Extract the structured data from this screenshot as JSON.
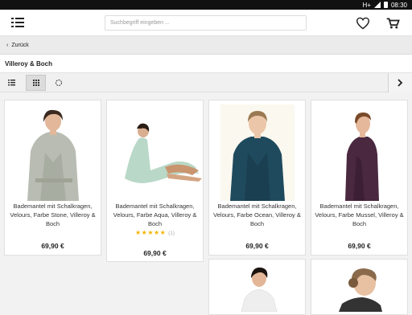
{
  "status": {
    "network": "H+",
    "time": "08:30"
  },
  "search": {
    "placeholder": "Suchbegriff eingeben ..."
  },
  "nav": {
    "back_label": "Zurück"
  },
  "category": {
    "title": "Villeroy & Boch"
  },
  "products": [
    {
      "name": "Bademantel mit Schalkragen, Velours, Farbe Stone, Villeroy & Boch",
      "price": "69,90 €",
      "color": "#b8bcb2"
    },
    {
      "name": "Bademantel mit Schalkragen, Velours, Farbe Aqua, Villeroy & Boch",
      "price": "69,90 €",
      "rating_stars": "★★★★★",
      "rating_count": "(1)",
      "rating": 5,
      "color": "#b9d8c8"
    },
    {
      "name": "Bademantel mit Schalkragen, Velours, Farbe Ocean, Villeroy & Boch",
      "price": "69,90 €",
      "color": "#1f4a5e"
    },
    {
      "name": "Bademantel mit Schalkragen, Velours, Farbe Mussel, Villeroy & Boch",
      "price": "69,90 €",
      "color": "#4a2840"
    },
    {
      "color": "#eeeeee"
    },
    {
      "color": "#333333"
    }
  ],
  "icons": {
    "menu": "menu-icon",
    "heart": "heart-icon",
    "cart": "cart-icon",
    "back": "chevron-left-icon",
    "list": "list-view-icon",
    "grid": "grid-view-icon",
    "filter": "filter-icon",
    "next": "chevron-right-icon"
  }
}
